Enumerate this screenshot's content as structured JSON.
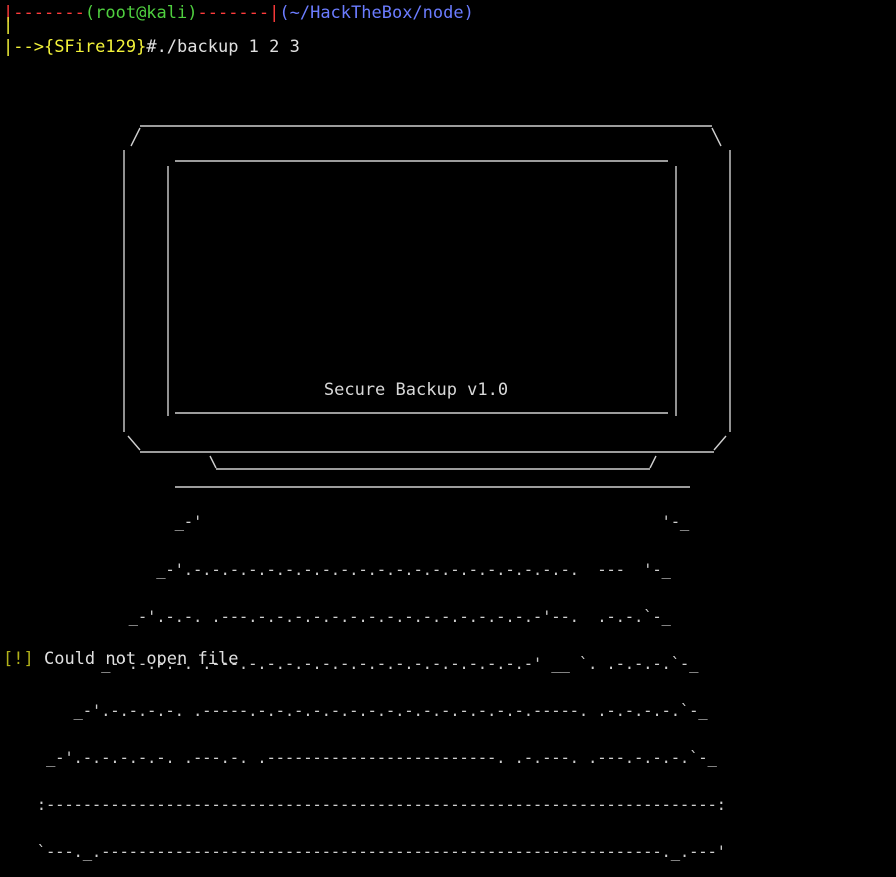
{
  "terminal": {
    "prompt": {
      "line1_left_dashes": "|-------",
      "line1_user": "(root@kali)",
      "line1_mid_dashes": "-------|",
      "line1_path": "(~/HackTheBox/node)",
      "line2_bar": "|",
      "line3_arrow": "|-->",
      "line3_name": "{SFire129}",
      "line3_hash": "#",
      "command": "./backup 1 2 3"
    },
    "screen_title": "Secure Backup v1.0",
    "keyboard_art": [
      "                   _-'                                                  '-_",
      "                 _-'.-.-.-.-.-.-.-.-.-.-.-.-.-.-.-.-.-.-.-.-.-.  ---  '-_",
      "              _-'.-.-. .---.-.-.-.-.-.-.-.-.-.-.-.-.-.-.-.-'--.  .-.-.`-_",
      "           _-'.-.-.-. .---.-.-.-.-.-.-.-.-.-.-.-.-.-.-.-.-' __ `. .-.-.-.`-_",
      "        _-'.-.-.-.-. .-----.-.-.-.-.-.-.-.-.-.-.-.-.-.-.-.-----. .-.-.-.-.`-_",
      "     _-'.-.-.-.-.-. .---.-. .-------------------------. .-.---. .---.-.-.-.`-_",
      "    :-------------------------------------------------------------------------:",
      "    `---._.-------------------------------------------------------------._.---'"
    ],
    "error": {
      "bracket": "[!]",
      "message": "Could not open file"
    }
  },
  "colors": {
    "background": "#000000",
    "text": "#d8d8d8",
    "red": "#ff3b3b",
    "green": "#4fcf3f",
    "blue": "#6b7cff",
    "yellow": "#f3f33a",
    "olive": "#b2b21a"
  }
}
